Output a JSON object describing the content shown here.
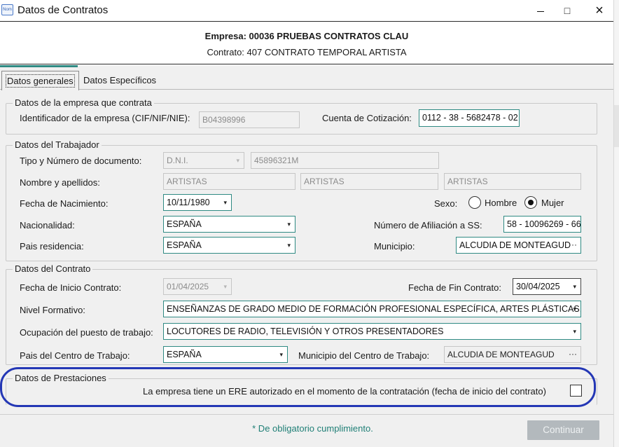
{
  "window": {
    "title": "Datos de Contratos",
    "app_icon_text": "Nom",
    "minimize": "",
    "maximize": "□",
    "close": "×"
  },
  "header": {
    "empresa": "Empresa: 00036 PRUEBAS CONTRATOS CLAU",
    "contrato": "Contrato: 407 CONTRATO TEMPORAL ARTISTA"
  },
  "tabs": [
    {
      "label": "Datos generales",
      "active": true
    },
    {
      "label": "Datos Específicos",
      "active": false
    }
  ],
  "empresa_section": {
    "legend": "Datos de la empresa que contrata",
    "identificador_label": "Identificador de la empresa (CIF/NIF/NIE):",
    "identificador_value": "B04398996",
    "cuenta_label": "Cuenta de Cotización:",
    "cuenta_value": "0112 - 38 - 5682478 - 02"
  },
  "trabajador": {
    "legend": "Datos del Trabajador",
    "tipo_doc_label": "Tipo y Número de documento:",
    "tipo_doc_value": "D.N.I.",
    "num_doc_value": "45896321M",
    "nombre_label": "Nombre y apellidos:",
    "nombre_value": "ARTISTAS",
    "apellido1_value": "ARTISTAS",
    "apellido2_value": "ARTISTAS",
    "fecha_nac_label": "Fecha de Nacimiento:",
    "fecha_nac_value": "10/11/1980",
    "sexo_label": "Sexo:",
    "sexo_options": [
      "Hombre",
      "Mujer"
    ],
    "sexo_selected": "Mujer",
    "nacionalidad_label": "Nacionalidad:",
    "nacionalidad_value": "ESPAÑA",
    "afiliacion_label": "Número de Afiliación a SS:",
    "afiliacion_value": "58 - 10096269 - 66",
    "pais_res_label": "Pais residencia:",
    "pais_res_value": "ESPAÑA",
    "municipio_label": "Municipio:",
    "municipio_value": "ALCUDIA DE MONTEAGUD"
  },
  "contrato_section": {
    "legend": "Datos del Contrato",
    "inicio_label": "Fecha de Inicio Contrato:",
    "inicio_value": "01/04/2025",
    "fin_label": "Fecha de Fin Contrato:",
    "fin_value": "30/04/2025",
    "nivel_label": "Nivel Formativo:",
    "nivel_value": "ENSEÑANZAS DE GRADO MEDIO DE FORMACIÓN PROFESIONAL ESPECÍFICA, ARTES PLÁSTICAS, D",
    "ocupacion_label": "Ocupación del puesto de trabajo:",
    "ocupacion_value": "LOCUTORES DE RADIO, TELEVISIÓN Y OTROS PRESENTADORES",
    "pais_centro_label": "Pais del Centro de Trabajo:",
    "pais_centro_value": "ESPAÑA",
    "municipio_centro_label": "Municipio del Centro de Trabajo:",
    "municipio_centro_value": "ALCUDIA DE MONTEAGUD"
  },
  "prestaciones": {
    "legend": "Datos de Prestaciones",
    "ere_label": "La empresa tiene un ERE autorizado en el momento de la contratación (fecha de inicio del contrato)",
    "ere_checked": false
  },
  "footer": {
    "note": "* De obligatorio cumplimiento.",
    "continuar_label": "Continuar"
  },
  "icons": {
    "dropdown": "▾",
    "ellipsis": "···"
  },
  "colors": {
    "accent_teal": "#2f8a83",
    "highlight_ellipse": "#2437b5",
    "note_text": "#1f7f76",
    "button_disabled": "#b3b9bd"
  }
}
